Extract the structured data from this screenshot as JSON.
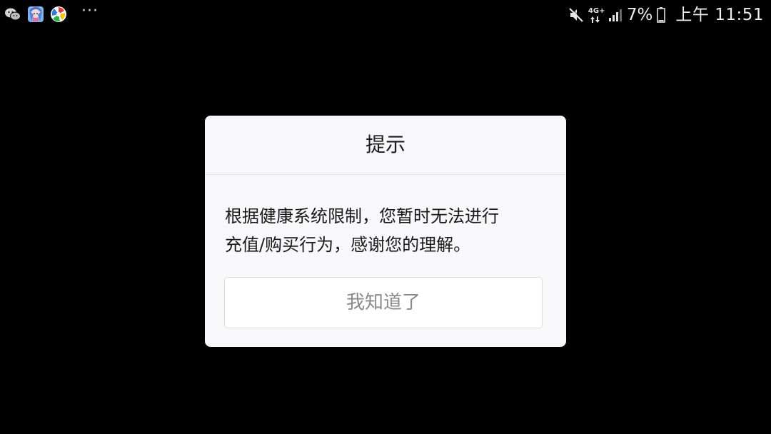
{
  "status_bar": {
    "notification_icons": [
      "wechat-icon",
      "game-app-icon",
      "pinwheel-app-icon"
    ],
    "more_label": "···",
    "network_label": "4G+",
    "battery_percent": "7%",
    "time": "上午 11:51"
  },
  "dialog": {
    "title": "提示",
    "message_lines": [
      "根据健康系统限制，您暂时无法进行",
      "充值/购买行为，感谢您的理解。"
    ],
    "confirm_label": "我知道了"
  },
  "colors": {
    "background": "#000000",
    "dialog_bg": "#f8f8fa",
    "button_text": "#8a8a8a"
  }
}
